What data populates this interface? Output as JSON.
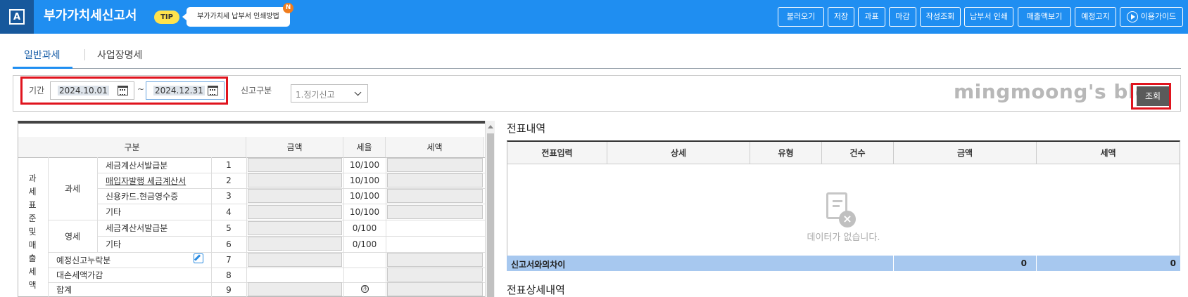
{
  "topbar": {
    "logo": "A",
    "title": "부가가치세신고서",
    "tip_badge": "TIP",
    "tip_text": "부가가치세 납부서 인쇄방법",
    "new_badge": "N",
    "buttons": [
      "불러오기",
      "저장",
      "과표",
      "마감",
      "작성조회",
      "납부서 인쇄",
      "매출액보기",
      "예정고지",
      "이용가이드"
    ],
    "bg_color": "#1f8ef1",
    "logo_bg": "#17589c"
  },
  "tabs": [
    "일반과세",
    "사업장명세"
  ],
  "filter": {
    "period_label": "기간",
    "date_from": "2024.10.01",
    "tilde": "~",
    "date_to": "2024.12.31",
    "report_type_label": "신고구분",
    "report_type_value": "1.정기신고",
    "search_button": "조회",
    "watermark": "mingmoong's blog"
  },
  "tax_table": {
    "headers": [
      "구분",
      "금액",
      "세율",
      "세액"
    ],
    "side_label": "과세표준및매출세액",
    "group_labels": [
      "과세",
      "영세"
    ],
    "rows": [
      {
        "label": "세금계산서발급분",
        "no": "1",
        "rate": "10/100"
      },
      {
        "label": "매입자발행 세금계산서",
        "no": "2",
        "rate": "10/100"
      },
      {
        "label": "신용카드.현금영수증",
        "no": "3",
        "rate": "10/100"
      },
      {
        "label": "기타",
        "no": "4",
        "rate": "10/100"
      },
      {
        "label": "세금계산서발급분",
        "no": "5",
        "rate": "0/100"
      },
      {
        "label": "기타",
        "no": "6",
        "rate": "0/100"
      },
      {
        "label": "예정신고누락분",
        "no": "7",
        "rate": ""
      },
      {
        "label": "대손세액가감",
        "no": "8",
        "rate": ""
      },
      {
        "label": "합계",
        "no": "9",
        "rate": "㉮"
      }
    ]
  },
  "voucher": {
    "title": "전표내역",
    "headers": [
      "전표입력",
      "상세",
      "유형",
      "건수",
      "금액",
      "세액"
    ],
    "empty_text": "데이터가 없습니다.",
    "diff_label": "신고서와의차이",
    "diff_amount": "0",
    "diff_tax": "0",
    "detail_title": "전표상세내역"
  },
  "icons": [
    "calendar-icon",
    "chevron-down-icon",
    "edit-icon",
    "play-icon",
    "empty-document-icon"
  ]
}
